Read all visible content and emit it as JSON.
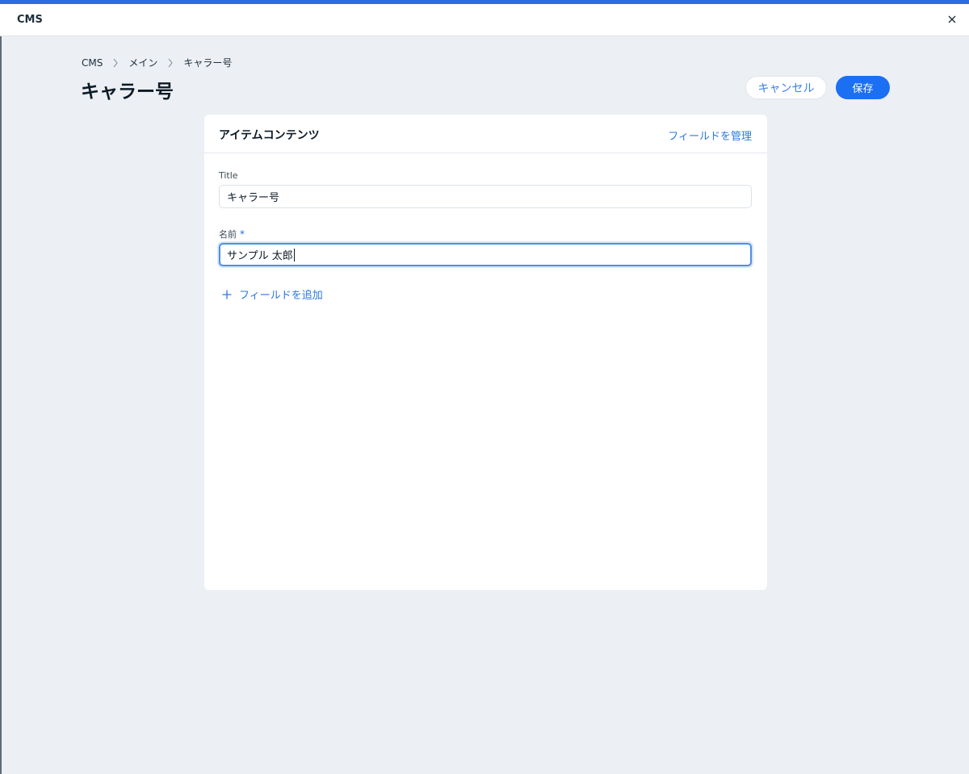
{
  "window": {
    "title": "CMS",
    "close_icon": "close-icon"
  },
  "breadcrumb": {
    "items": [
      "CMS",
      "メイン",
      "キャラー号"
    ],
    "separator_icon": "chevron-right-icon"
  },
  "page": {
    "title": "キャラー号"
  },
  "actions": {
    "cancel_label": "キャンセル",
    "save_label": "保存"
  },
  "card": {
    "title": "アイテムコンテンツ",
    "manage_fields_label": "フィールドを管理",
    "fields": [
      {
        "label": "Title",
        "value": "キャラー号",
        "required": false
      },
      {
        "label": "名前",
        "value": "サンプル 太郎",
        "required": true,
        "required_mark": "*"
      }
    ],
    "add_field_label": "フィールドを追加",
    "add_field_icon": "plus-icon"
  },
  "colors": {
    "accent": "#1b6ff2",
    "link": "#2c78e1",
    "background": "#eceff3"
  }
}
